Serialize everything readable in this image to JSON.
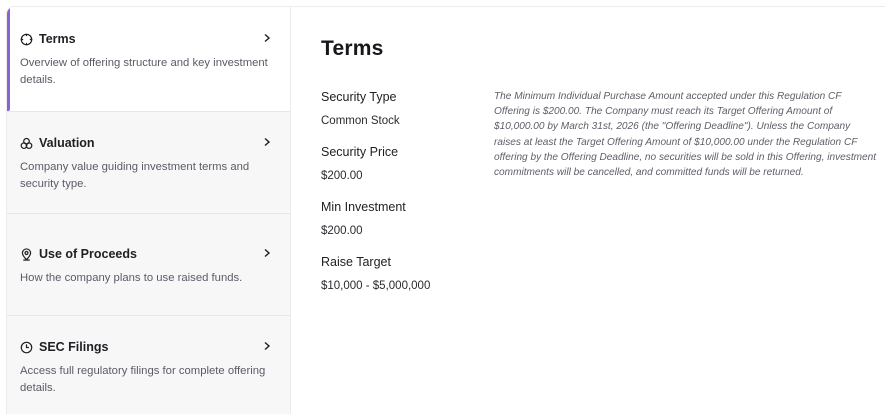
{
  "sidebar": {
    "items": [
      {
        "label": "Terms",
        "description": "Overview of offering structure and key investment details.",
        "icon": "crosshair-icon"
      },
      {
        "label": "Valuation",
        "description": "Company value guiding investment terms and security type.",
        "icon": "users-icon"
      },
      {
        "label": "Use of Proceeds",
        "description": "How the company plans to use raised funds.",
        "icon": "location-pin-icon"
      },
      {
        "label": "SEC Filings",
        "description": "Access full regulatory filings for complete offering details.",
        "icon": "clock-icon"
      }
    ]
  },
  "main": {
    "title": "Terms",
    "facts": [
      {
        "label": "Security Type",
        "value": "Common Stock"
      },
      {
        "label": "Security Price",
        "value": "$200.00"
      },
      {
        "label": "Min Investment",
        "value": "$200.00"
      },
      {
        "label": "Raise Target",
        "value": "$10,000 - $5,000,000"
      }
    ],
    "disclaimer": "The Minimum Individual Purchase Amount accepted under this Regulation CF Offering is $200.00. The Company must reach its Target Offering Amount of $10,000.00 by March 31st, 2026 (the \"Offering Deadline\"). Unless the Company raises at least the Target Offering Amount of $10,000.00 under the Regulation CF offering by the Offering Deadline, no securities will be sold in this Offering, investment commitments will be cancelled, and committed funds will be returned."
  },
  "colors": {
    "accent": "#8a63d2",
    "sidebar_bg": "#f7f7f8"
  }
}
